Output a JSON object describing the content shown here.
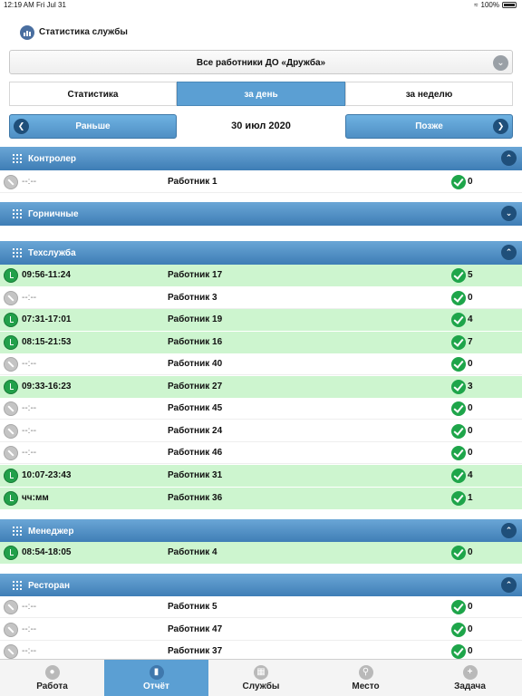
{
  "status_bar": {
    "time": "12:19 AM",
    "date": "Fri Jul 31",
    "battery": "100%"
  },
  "header": {
    "title": "Статистика службы"
  },
  "worker_filter": {
    "selected": "Все работники ДО «Дружба»"
  },
  "segments": {
    "stats": "Статистика",
    "day": "за день",
    "week": "за неделю"
  },
  "date_nav": {
    "prev": "Раньше",
    "date": "30 июл 2020",
    "next": "Позже"
  },
  "groups": [
    {
      "title": "Контролер",
      "expanded": true,
      "rows": [
        {
          "time": "--:--",
          "worker": "Работник 1",
          "count": "0",
          "active": false
        }
      ]
    },
    {
      "title": "Горничные",
      "expanded": false,
      "rows": []
    },
    {
      "title": "Техслужба",
      "expanded": true,
      "rows": [
        {
          "time": "09:56-11:24",
          "worker": "Работник 17",
          "count": "5",
          "active": true
        },
        {
          "time": "--:--",
          "worker": "Работник 3",
          "count": "0",
          "active": false
        },
        {
          "time": "07:31-17:01",
          "worker": "Работник 19",
          "count": "4",
          "active": true
        },
        {
          "time": "08:15-21:53",
          "worker": "Работник 16",
          "count": "7",
          "active": true
        },
        {
          "time": "--:--",
          "worker": "Работник 40",
          "count": "0",
          "active": false
        },
        {
          "time": "09:33-16:23",
          "worker": "Работник 27",
          "count": "3",
          "active": true
        },
        {
          "time": "--:--",
          "worker": "Работник 45",
          "count": "0",
          "active": false
        },
        {
          "time": "--:--",
          "worker": "Работник 24",
          "count": "0",
          "active": false
        },
        {
          "time": "--:--",
          "worker": "Работник 46",
          "count": "0",
          "active": false
        },
        {
          "time": "10:07-23:43",
          "worker": "Работник 31",
          "count": "4",
          "active": true
        },
        {
          "time": "чч:мм",
          "worker": "Работник 36",
          "count": "1",
          "active": true
        }
      ]
    },
    {
      "title": "Менеджер",
      "expanded": true,
      "rows": [
        {
          "time": "08:54-18:05",
          "worker": "Работник 4",
          "count": "0",
          "active": true
        }
      ]
    },
    {
      "title": "Ресторан",
      "expanded": true,
      "rows": [
        {
          "time": "--:--",
          "worker": "Работник 5",
          "count": "0",
          "active": false
        },
        {
          "time": "--:--",
          "worker": "Работник 47",
          "count": "0",
          "active": false
        },
        {
          "time": "--:--",
          "worker": "Работник 37",
          "count": "0",
          "active": false
        }
      ]
    }
  ],
  "tabbar": [
    {
      "label": "Работа",
      "icon": "person-icon",
      "active": false
    },
    {
      "label": "Отчёт",
      "icon": "chart-icon",
      "active": true
    },
    {
      "label": "Службы",
      "icon": "grid-icon",
      "active": false
    },
    {
      "label": "Место",
      "icon": "location-pin-icon",
      "active": false
    },
    {
      "label": "Задача",
      "icon": "plus-icon",
      "active": false
    }
  ],
  "colors": {
    "accent": "#5b9fd3",
    "active_row": "#cdf5cf",
    "group_header": "#3e7db5",
    "check": "#1ea54a"
  }
}
